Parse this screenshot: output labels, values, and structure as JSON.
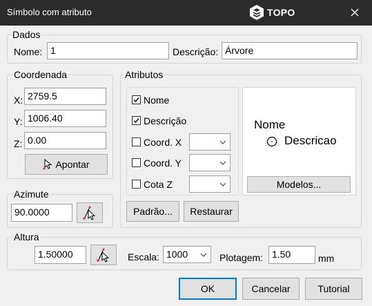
{
  "window": {
    "title": "Símbolo com atributo",
    "brand": "TOPO"
  },
  "dados": {
    "label": "Dados",
    "nome_label": "Nome:",
    "nome_value": "1",
    "descricao_label": "Descrição:",
    "descricao_value": "Árvore"
  },
  "coordenada": {
    "label": "Coordenada",
    "x_label": "X:",
    "x_value": "2759.5",
    "y_label": "Y:",
    "y_value": "1006.40",
    "z_label": "Z:",
    "z_value": "0.00",
    "apontar_label": "Apontar"
  },
  "azimute": {
    "label": "Azimute",
    "value": "90.0000"
  },
  "atributos": {
    "label": "Atributos",
    "nome": {
      "label": "Nome",
      "checked": true
    },
    "descricao": {
      "label": "Descrição",
      "checked": true
    },
    "coord_x": {
      "label": "Coord. X",
      "checked": false,
      "value": ""
    },
    "coord_y": {
      "label": "Coord. Y",
      "checked": false,
      "value": ""
    },
    "cota_z": {
      "label": "Cota Z",
      "checked": false,
      "value": ""
    },
    "padrao_label": "Padrão...",
    "restaurar_label": "Restaurar",
    "modelos_label": "Modelos...",
    "preview": {
      "line1": "Nome",
      "line2": "Descricao"
    }
  },
  "altura": {
    "label": "Altura",
    "value": "1.50000",
    "escala_label": "Escala:",
    "escala_value": "1000",
    "plotagem_label": "Plotagem:",
    "plotagem_value": "1.50",
    "unit": "mm"
  },
  "footer": {
    "ok_label": "OK",
    "cancelar_label": "Cancelar",
    "tutorial_label": "Tutorial"
  },
  "colors": {
    "titlebar": "#2b2b2b",
    "accent": "#0078d7",
    "window_bg": "#f0f0f0"
  }
}
